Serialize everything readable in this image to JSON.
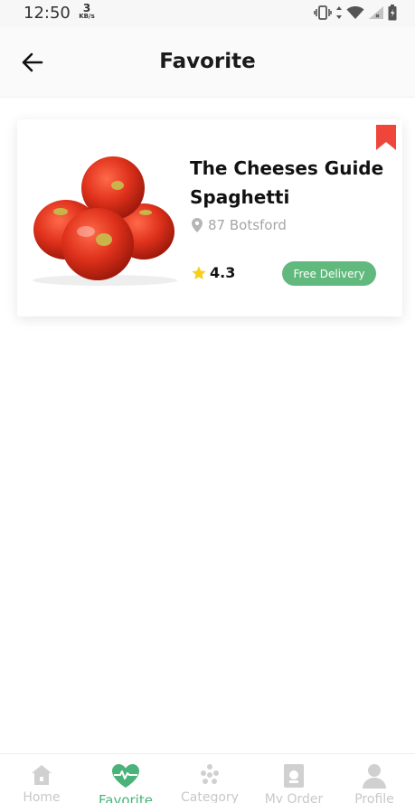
{
  "status_bar": {
    "time": "12:50",
    "speed_value": "3",
    "speed_unit": "KB/s",
    "icons": [
      "vibrate-icon",
      "data-arrows-icon",
      "wifi-icon",
      "signal-icon",
      "battery-icon"
    ]
  },
  "header": {
    "title": "Favorite",
    "back_icon": "arrow-left-icon"
  },
  "favorites": [
    {
      "title": "The Cheeses Guide Spaghetti",
      "location": "87 Botsford",
      "rating": "4.3",
      "badge": "Free Delivery",
      "image": "tomatoes",
      "bookmark_color": "#f0453a"
    }
  ],
  "bottom_nav": {
    "items": [
      {
        "label": "Home",
        "icon": "home-icon"
      },
      {
        "label": "Favorite",
        "icon": "heart-pulse-icon",
        "active": true
      },
      {
        "label": "Category",
        "icon": "category-dots-icon"
      },
      {
        "label": "My Order",
        "icon": "order-book-icon"
      },
      {
        "label": "Profile",
        "icon": "profile-icon"
      }
    ]
  },
  "colors": {
    "accent": "#4ab37a",
    "badge": "#61b97d",
    "bookmark": "#f0453a",
    "star": "#f7cf1d",
    "inactive": "#c8c8c8"
  }
}
